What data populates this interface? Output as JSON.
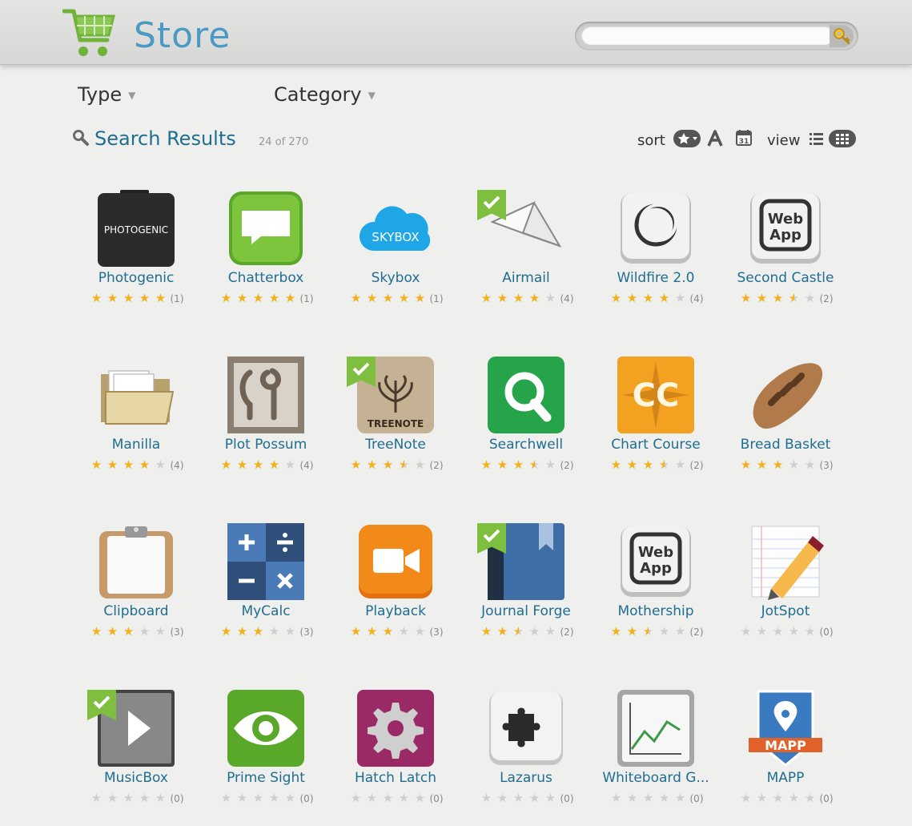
{
  "header": {
    "title": "Store",
    "search": {
      "value": "",
      "placeholder": ""
    }
  },
  "filters": {
    "type_label": "Type",
    "category_label": "Category"
  },
  "results": {
    "title": "Search Results",
    "count_text": "24 of 270"
  },
  "controls": {
    "sort_label": "sort",
    "view_label": "view"
  },
  "apps": [
    {
      "name": "Photogenic",
      "rating": 5,
      "count": "(1)",
      "installed": false,
      "icon": "photogenic-icon"
    },
    {
      "name": "Chatterbox",
      "rating": 5,
      "count": "(1)",
      "installed": false,
      "icon": "chat-bubble-icon"
    },
    {
      "name": "Skybox",
      "rating": 5,
      "count": "(1)",
      "installed": false,
      "icon": "cloud-icon"
    },
    {
      "name": "Airmail",
      "rating": 4,
      "count": "(4)",
      "installed": true,
      "icon": "paper-plane-icon"
    },
    {
      "name": "Wildfire 2.0",
      "rating": 4,
      "count": "(4)",
      "installed": false,
      "icon": "ring-icon"
    },
    {
      "name": "Second Castle",
      "rating": 3.5,
      "count": "(2)",
      "installed": false,
      "icon": "web-app-icon"
    },
    {
      "name": "Manilla",
      "rating": 4,
      "count": "(4)",
      "installed": false,
      "icon": "folder-icon"
    },
    {
      "name": "Plot Possum",
      "rating": 4,
      "count": "(4)",
      "installed": false,
      "icon": "plot-possum-icon"
    },
    {
      "name": "TreeNote",
      "rating": 3.5,
      "count": "(2)",
      "installed": true,
      "icon": "treenote-icon"
    },
    {
      "name": "Searchwell",
      "rating": 3.5,
      "count": "(2)",
      "installed": false,
      "icon": "magnifier-q-icon"
    },
    {
      "name": "Chart Course",
      "rating": 3.5,
      "count": "(2)",
      "installed": false,
      "icon": "compass-cc-icon"
    },
    {
      "name": "Bread Basket",
      "rating": 3,
      "count": "(3)",
      "installed": false,
      "icon": "bread-icon"
    },
    {
      "name": "Clipboard",
      "rating": 3,
      "count": "(3)",
      "installed": false,
      "icon": "clipboard-icon"
    },
    {
      "name": "MyCalc",
      "rating": 3,
      "count": "(3)",
      "installed": false,
      "icon": "calculator-icon"
    },
    {
      "name": "Playback",
      "rating": 3,
      "count": "(3)",
      "installed": false,
      "icon": "video-camera-icon"
    },
    {
      "name": "Journal Forge",
      "rating": 2.5,
      "count": "(2)",
      "installed": true,
      "icon": "journal-icon"
    },
    {
      "name": "Mothership",
      "rating": 2.5,
      "count": "(2)",
      "installed": false,
      "icon": "web-app-icon"
    },
    {
      "name": "JotSpot",
      "rating": 0,
      "count": "(0)",
      "installed": false,
      "icon": "pencil-paper-icon"
    },
    {
      "name": "MusicBox",
      "rating": 0,
      "count": "(0)",
      "installed": true,
      "icon": "play-icon"
    },
    {
      "name": "Prime Sight",
      "rating": 0,
      "count": "(0)",
      "installed": false,
      "icon": "eye-icon"
    },
    {
      "name": "Hatch Latch",
      "rating": 0,
      "count": "(0)",
      "installed": false,
      "icon": "gear-icon"
    },
    {
      "name": "Lazarus",
      "rating": 0,
      "count": "(0)",
      "installed": false,
      "icon": "puzzle-icon"
    },
    {
      "name": "Whiteboard G...",
      "rating": 0,
      "count": "(0)",
      "installed": false,
      "icon": "whiteboard-chart-icon"
    },
    {
      "name": "MAPP",
      "rating": 0,
      "count": "(0)",
      "installed": false,
      "icon": "map-pin-icon"
    }
  ],
  "icon_text": {
    "photogenic": "PHOTOGENIC",
    "skybox": "SKYBOX",
    "webapp_1": "Web",
    "webapp_2": "App",
    "treenote": "TREENOTE",
    "mapp": "MAPP",
    "calendar_day": "31"
  }
}
